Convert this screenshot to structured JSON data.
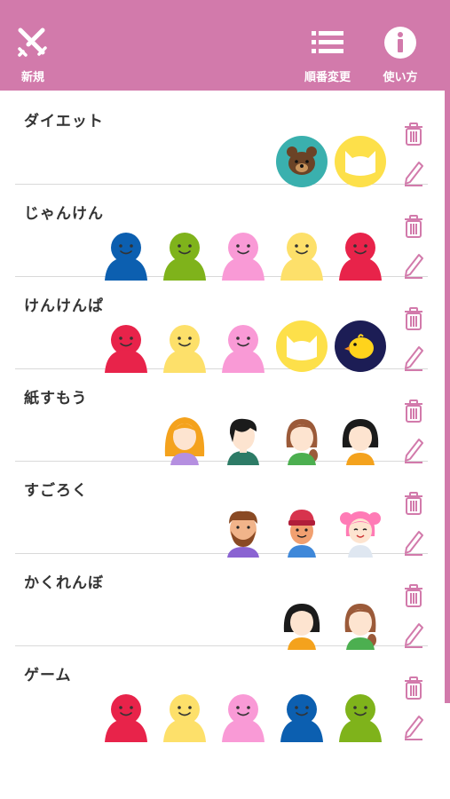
{
  "header": {
    "new_label": "新規",
    "reorder_label": "順番変更",
    "howto_label": "使い方",
    "bg_color": "#d27aab"
  },
  "items": [
    {
      "title": "ダイエット",
      "avatars": [
        "bear",
        "cat-yellow"
      ]
    },
    {
      "title": "じゃんけん",
      "avatars": [
        "blob-blue",
        "blob-green",
        "blob-pink",
        "blob-yellow",
        "blob-red"
      ]
    },
    {
      "title": "けんけんぱ",
      "avatars": [
        "blob-red",
        "blob-yellow",
        "blob-pink",
        "cat-yellow",
        "chick"
      ]
    },
    {
      "title": "紙すもう",
      "avatars": [
        "girl-orange",
        "boy-black",
        "girl-brown",
        "girl-black"
      ]
    },
    {
      "title": "すごろく",
      "avatars": [
        "man-beard",
        "boy-hat",
        "girl-pink"
      ]
    },
    {
      "title": "かくれんぼ",
      "avatars": [
        "girl-black",
        "girl-brown"
      ]
    },
    {
      "title": "ゲーム",
      "avatars": [
        "blob-red",
        "blob-yellow",
        "blob-pink",
        "blob-blue",
        "blob-green"
      ]
    }
  ],
  "icons": {
    "new": "swords-icon",
    "reorder": "list-icon",
    "howto": "info-icon",
    "delete": "trash-icon",
    "edit": "pencil-icon"
  },
  "colors": {
    "accent": "#d27aab",
    "blob-red": "#e8234a",
    "blob-yellow": "#fde06a",
    "blob-pink": "#f99ad6",
    "blob-blue": "#0c5fb0",
    "blob-green": "#7fb31b"
  }
}
